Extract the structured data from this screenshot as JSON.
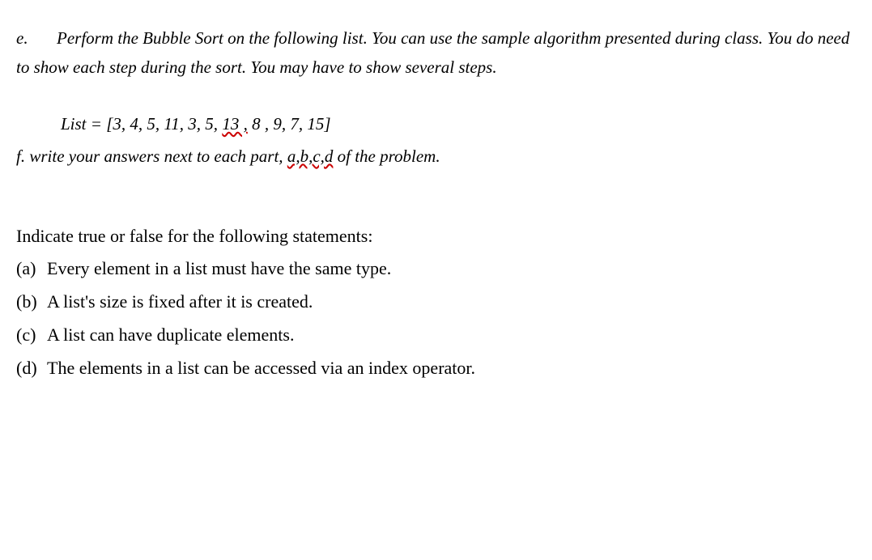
{
  "question_e": {
    "label": "e.",
    "text_part1": "Perform the Bubble Sort on the following list. You can use the sample algorithm presented during class. You do need to show each step during the sort. You may have to show several steps."
  },
  "list_line": {
    "prefix": "List = [3, 4, 5, 11, 3, 5, ",
    "underlined": "13 ,",
    "suffix": " 8 , 9, 7, 15]"
  },
  "question_f": {
    "label": "f.",
    "text_before": " write your answers next to each part, ",
    "squiggle": "a,b,c,d",
    "text_after": "  of the problem."
  },
  "tf_intro": "Indicate true or false for the following statements:",
  "tf_items": {
    "a": {
      "label": "(a)",
      "text": "Every element in a list must have the same type."
    },
    "b": {
      "label": "(b)",
      "text": "A list's size is fixed after it is created."
    },
    "c": {
      "label": "(c)",
      "text": "A list can have duplicate elements."
    },
    "d": {
      "label": "(d)",
      "text": "The elements in a list can be accessed via an index operator."
    }
  }
}
